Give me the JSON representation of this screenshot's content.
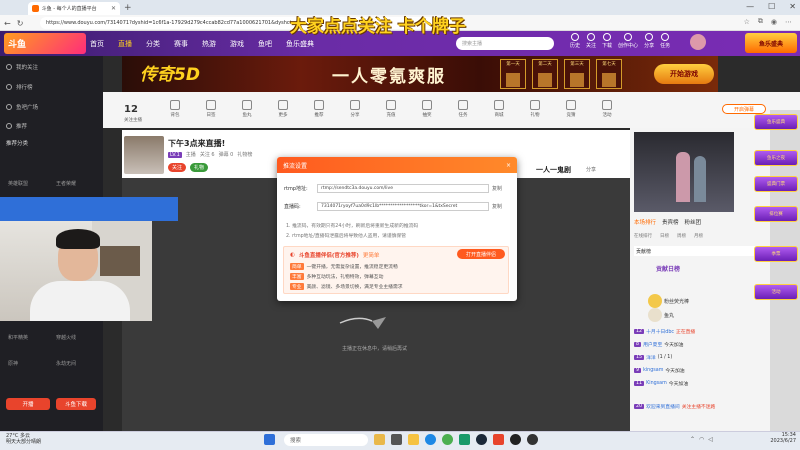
{
  "browser": {
    "tab_title": "斗鱼 - 每个人的直播平台",
    "url": "https://www.douyu.com/7314071?dyshid=1c6f1a-17929d279c4ccab82cd77a1000621701&dyshci=",
    "window_controls": [
      "—",
      "☐",
      "✕"
    ]
  },
  "overlay_banner": "大家点点关注 卡个牌子",
  "site": {
    "logo_text": "斗鱼",
    "nav": [
      "首页",
      "直播",
      "分类",
      "赛事",
      "热游",
      "游戏",
      "鱼吧",
      "鱼乐盛典"
    ],
    "active_nav": "直播",
    "search_placeholder": "搜索主播",
    "header_icons": [
      "历史",
      "关注",
      "下载",
      "创作中心",
      "分享",
      "任务"
    ],
    "header_promo": "鱼乐盛典"
  },
  "sidebar": {
    "items": [
      "我的关注",
      "排行榜",
      "鱼吧广场",
      "推荐"
    ],
    "section_title": "推荐分类",
    "categories": [
      "英雄联盟",
      "王者荣耀",
      "和平精英",
      "穿越火线",
      "原神",
      "永劫无间"
    ],
    "button_left": "开播",
    "button_right": "斗鱼下载"
  },
  "ad": {
    "brand": "传奇5D",
    "slogan": "一人零氪爽服",
    "days": [
      "第一天",
      "第二天",
      "第三天",
      "第七天"
    ],
    "cta": "开始游戏"
  },
  "toolbar": {
    "count": "12",
    "count_label": "关注主播",
    "tools": [
      "背包",
      "日签",
      "鱼丸",
      "更多",
      "推荐",
      "分享",
      "充值",
      "抽奖",
      "任务",
      "商城",
      "礼物",
      "竞猜",
      "活动"
    ],
    "right_button": "开启弹幕"
  },
  "stream": {
    "title": "下午3点来直播!",
    "meta": [
      "主播",
      "关注 6",
      "弹幕 0",
      "礼物榜"
    ],
    "tag": "LV.1",
    "buttons": [
      "关注",
      "礼物"
    ],
    "right_title": "一人一鬼剧",
    "share": "分享",
    "loading_text": "主播正在休息中，请稍后再试"
  },
  "modal": {
    "title": "推流设置",
    "close": "×",
    "rtmp_label": "rtmp地址:",
    "rtmp_value": "rtmp://sendtc3a.douyu.com/live",
    "key_label": "直播码:",
    "key_value": "7314071ryoyf7ua0d9c1lb******************tkor=1&txSecret",
    "copy": "复制",
    "notes": [
      "1. 推流码，有效期只有24小时，刷新后将重新生成新的推流码",
      "2. rtmp地址/直播码泄露后将导致他人盗用，请谨慎保管"
    ],
    "promo_title": "斗鱼直播伴侣(官方推荐)",
    "promo_sub": "更简单",
    "promo_button": "打开直播伴侣",
    "promo_lines": [
      {
        "k": "简单",
        "v": "一键开播，无需复杂设置，推流稳定更流畅"
      },
      {
        "k": "丰富",
        "v": "多种互动玩法，礼物特效，弹幕互动"
      },
      {
        "k": "专业",
        "v": "美颜、滤镜、多场景切换，满足专业主播需求"
      }
    ]
  },
  "right_panel": {
    "tabs": [
      "本场排行",
      "贵宾榜",
      "粉丝团"
    ],
    "active_tab": "本场排行",
    "sub_tabs": [
      "在线排行",
      "日榜",
      "周榜",
      "月榜"
    ],
    "rank_bar": "贡献榜",
    "rank_title": "贡献日榜",
    "gifts": [
      "粉丝荧光棒",
      "鱼丸"
    ],
    "chat": [
      {
        "lv": "12",
        "name": "十月十日dbc",
        "text": "正在直播"
      },
      {
        "lv": "8",
        "name": "用户夏至",
        "text": "今天加油"
      },
      {
        "lv": "15",
        "name": "洋洋",
        "text": "(1 / 1)"
      },
      {
        "lv": "9",
        "name": "kingsam",
        "text": "今天加油"
      },
      {
        "lv": "11",
        "name": "Kingsam",
        "text": "今天加油"
      },
      {
        "lv": "20",
        "name": "欢迎来到直播间",
        "text": "关注主播不迷路"
      }
    ]
  },
  "events": [
    "鱼乐盛典",
    "鱼乐之夜",
    "盛典门票",
    "排位赛",
    "季票",
    "活动"
  ],
  "taskbar": {
    "weather_line1": "27°C 多云",
    "weather_line2": "明天大部分晴朗",
    "search": "搜索",
    "time": "15:34",
    "date": "2023/6/27"
  }
}
